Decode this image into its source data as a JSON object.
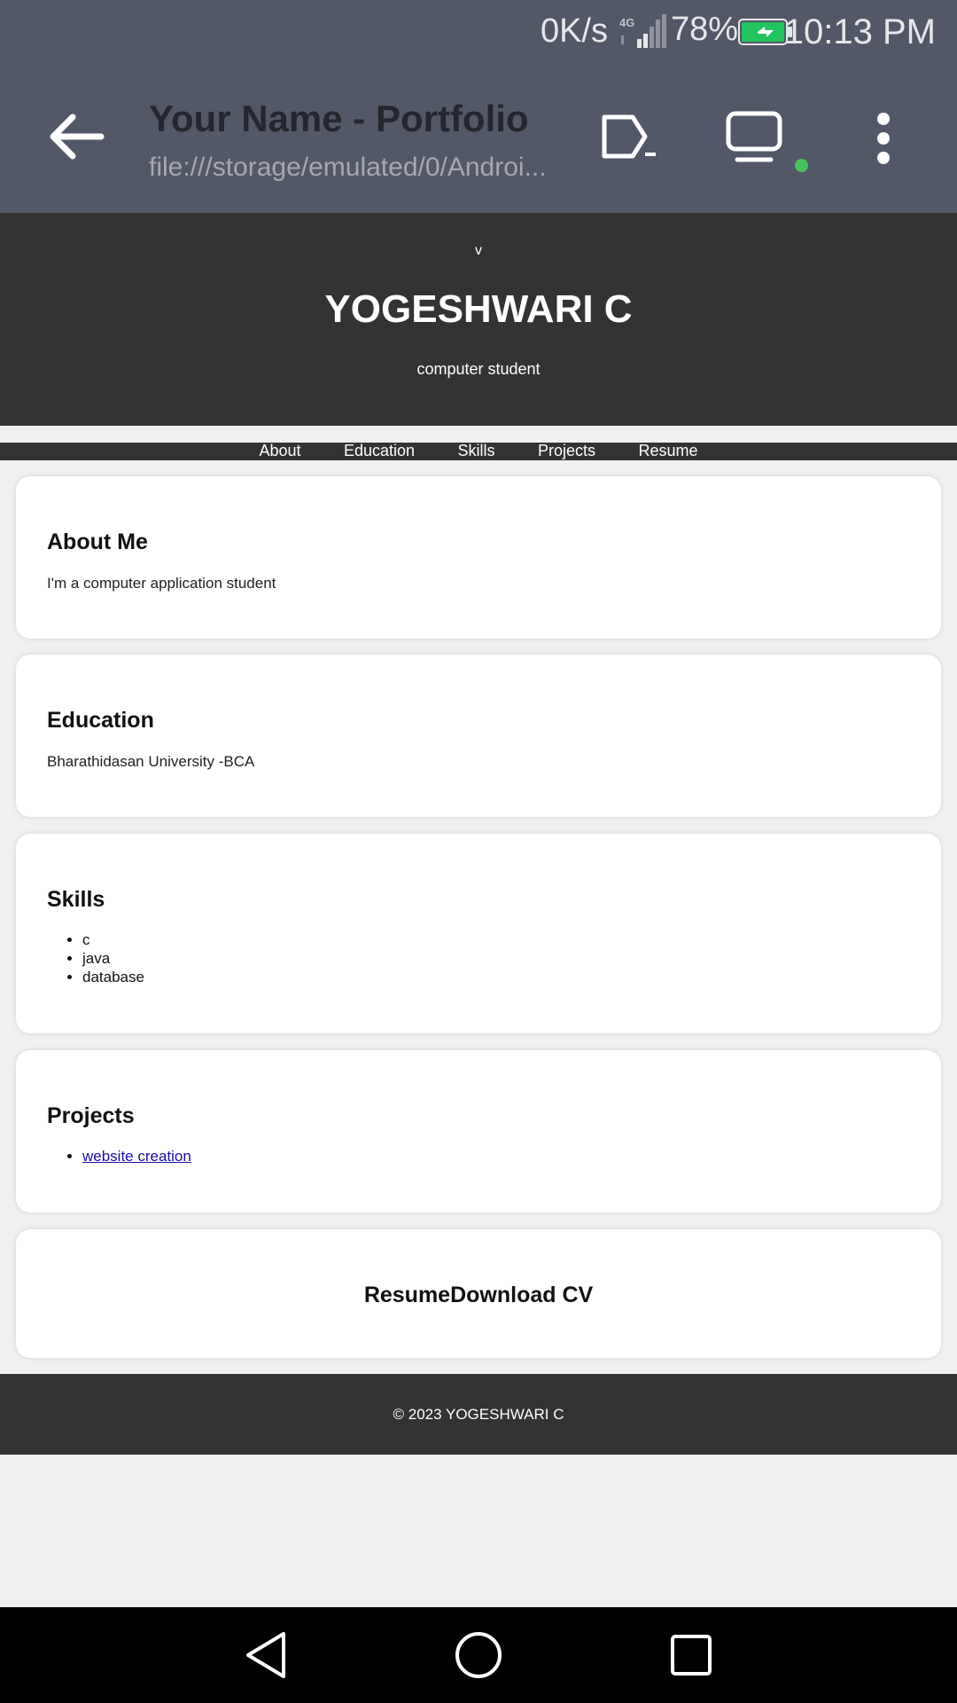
{
  "status_bar": {
    "net_speed": "0K/s",
    "network_type": "4G",
    "battery_percent": "78%",
    "time": "10:13 PM",
    "battery_color": "#22c55e"
  },
  "browser": {
    "title": "Your Name - Portfolio",
    "url": "file:///storage/emulated/0/Androi...",
    "icons": [
      "arrow-left-icon",
      "share-icon",
      "desktop-icon",
      "more-vert-icon"
    ],
    "status_dot_color": "#44c45b"
  },
  "hero": {
    "marker": "v",
    "name": "YOGESHWARI C",
    "subtitle": "computer student"
  },
  "nav": {
    "items": [
      "About",
      "Education",
      "Skills",
      "Projects",
      "Resume"
    ]
  },
  "about": {
    "heading": "About Me",
    "text": "I'm a computer application student"
  },
  "education": {
    "heading": "Education",
    "text": "Bharathidasan University -BCA"
  },
  "skills": {
    "heading": "Skills",
    "items": [
      "c",
      "java",
      "database"
    ]
  },
  "projects": {
    "heading": "Projects",
    "items": [
      "website creation"
    ]
  },
  "resume": {
    "text": "ResumeDownload CV"
  },
  "footer": {
    "text": "© 2023 YOGESHWARI C"
  },
  "system_nav": [
    "back-triangle-icon",
    "home-circle-icon",
    "recents-square-icon"
  ]
}
